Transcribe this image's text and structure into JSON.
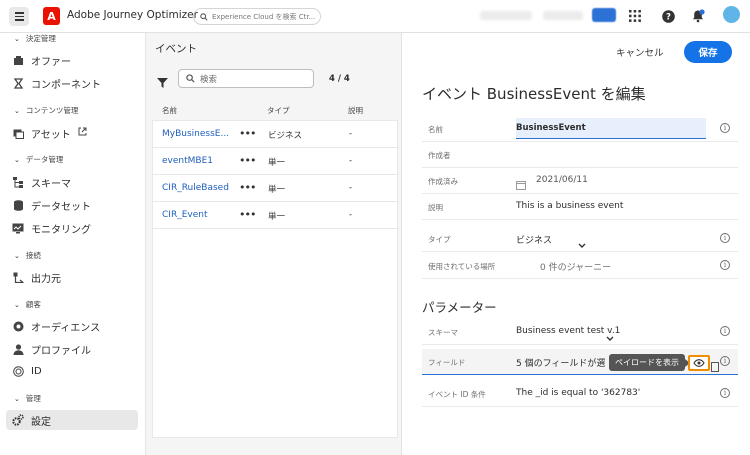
{
  "topbar": {
    "app_title": "Adobe Journey Optimizer",
    "logo_letter": "A",
    "search_placeholder": "Experience Cloud を検索 Ctr..."
  },
  "sidebar": {
    "sections": [
      {
        "label": "決定管理"
      },
      {
        "label": "コンテンツ管理"
      },
      {
        "label": "データ管理"
      },
      {
        "label": "接続"
      },
      {
        "label": "顧客"
      },
      {
        "label": "管理"
      }
    ],
    "items": [
      {
        "label": "オファー"
      },
      {
        "label": "コンポーネント"
      },
      {
        "label": "アセット"
      },
      {
        "label": "スキーマ"
      },
      {
        "label": "データセット"
      },
      {
        "label": "モニタリング"
      },
      {
        "label": "出力元"
      },
      {
        "label": "オーディエンス"
      },
      {
        "label": "プロファイル"
      },
      {
        "label": "ID"
      },
      {
        "label": "設定"
      }
    ]
  },
  "list": {
    "title": "イベント",
    "search_placeholder": "検索",
    "count": "4 / 4",
    "columns": [
      "名前",
      "タイプ",
      "説明"
    ],
    "rows": [
      {
        "name": "MyBusinessE...",
        "type": "ビジネス",
        "desc": "-"
      },
      {
        "name": "eventMBE1",
        "type": "単一",
        "desc": "-"
      },
      {
        "name": "CIR_RuleBased",
        "type": "単一",
        "desc": "-"
      },
      {
        "name": "CIR_Event",
        "type": "単一",
        "desc": "-"
      }
    ]
  },
  "panel": {
    "cancel_label": "キャンセル",
    "save_label": "保存",
    "title": "イベント BusinessEvent を編集",
    "fields": {
      "name_label": "名前",
      "name_value": "BusinessEvent",
      "author_label": "作成者",
      "author_value": "",
      "created_label": "作成済み",
      "created_value": "2021/06/11",
      "desc_label": "説明",
      "desc_value": "This is a business event",
      "type_label": "タイプ",
      "type_value": "ビジネス",
      "used_label": "使用されている場所",
      "used_value": "0 件のジャーニー"
    },
    "params_title": "パラメーター",
    "params": {
      "schema_label": "スキーマ",
      "schema_value": "Business event test v.1",
      "field_label": "フィールド",
      "field_value": "5 個のフィールドが選",
      "eventid_label": "イベント ID 条件",
      "eventid_value": "The _id is equal to '362783'"
    },
    "tooltip": "ペイロードを表示"
  },
  "colors": {
    "accent": "#1473e6",
    "link": "#1f5fbf",
    "highlight": "#f08c00",
    "logo": "#eb1000"
  }
}
